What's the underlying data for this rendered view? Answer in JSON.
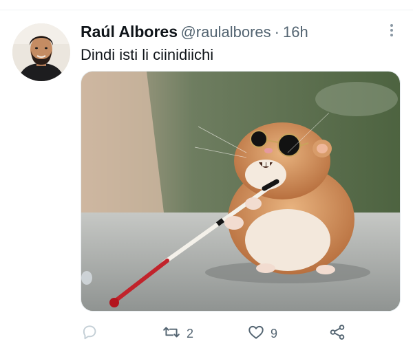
{
  "tweet": {
    "author_name": "Raúl Albores",
    "handle": "@raulalbores",
    "separator": "·",
    "time": "16h",
    "text": "Dindi isti li ciinidiichi",
    "actions": {
      "reply_count": "",
      "retweet_count": "2",
      "like_count": "9"
    }
  },
  "icons": {
    "more": "more-vertical-icon",
    "reply": "reply-icon",
    "retweet": "retweet-icon",
    "like": "heart-icon",
    "share": "share-icon"
  },
  "colors": {
    "text_primary": "#0f1419",
    "text_secondary": "#536471",
    "icon_muted": "#c4cfd6"
  }
}
